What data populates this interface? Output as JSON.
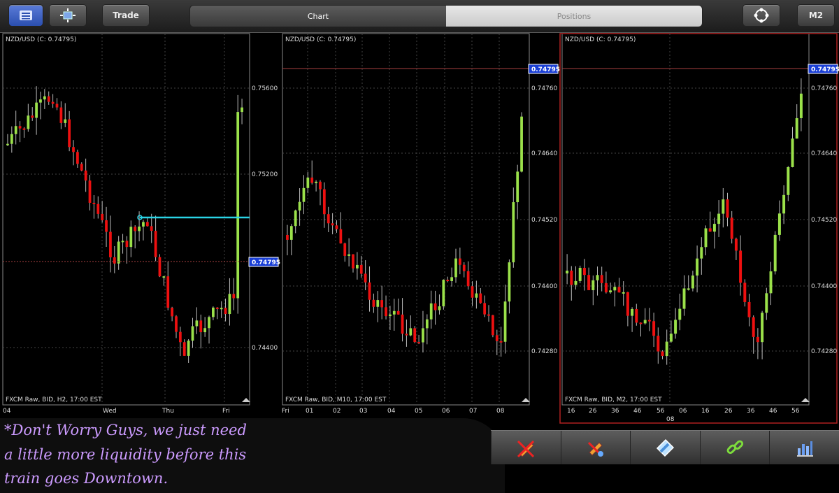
{
  "toolbar": {
    "trade_label": "Trade",
    "tab_chart": "Chart",
    "tab_positions": "Positions",
    "timeframe_label": "M2"
  },
  "charts": [
    {
      "title": "NZD/USD (C: 0.74795)",
      "source_label": "FXCM Raw, BID, H2, 17:00 EST",
      "price_ticks": [
        "0.75600",
        "0.75200",
        "0.74400"
      ],
      "current_price": "0.74795",
      "time_ticks": [
        "04",
        "Wed",
        "Thu",
        "Fri"
      ]
    },
    {
      "title": "NZD/USD (C: 0.74795)",
      "source_label": "FXCM Raw, BID, M10, 17:00 EST",
      "price_ticks": [
        "0.74760",
        "0.74640",
        "0.74520",
        "0.74400",
        "0.74280"
      ],
      "current_price": "0.74795",
      "time_ticks": [
        "Fri",
        "01",
        "02",
        "03",
        "04",
        "05",
        "06",
        "07",
        "08"
      ]
    },
    {
      "title": "NZD/USD (C: 0.74795)",
      "source_label": "FXCM Raw, BID, M2, 17:00 EST",
      "price_ticks": [
        "0.74760",
        "0.74640",
        "0.74520",
        "0.74400",
        "0.74280"
      ],
      "current_price": "0.74795",
      "time_ticks": [
        "16",
        "26",
        "36",
        "46",
        "56",
        "06",
        "16",
        "26",
        "36",
        "46",
        "56"
      ],
      "time_sub_label": "08"
    }
  ],
  "annotation": {
    "line1": "*Don't Worry Guys, we just need",
    "line2": "a little more liquidity before this",
    "line3": "train goes Downtown."
  },
  "icons": [
    "menu-icon",
    "crosshair-icon",
    "cycle-icon",
    "pencil-delete-icon",
    "pencil-settings-icon",
    "eraser-icon",
    "link-icon",
    "indicators-icon"
  ],
  "colors": {
    "bull": "#9be14a",
    "bear": "#ee1010",
    "accent_blue": "#1a3fd6",
    "selected_frame": "#b02020",
    "level_line": "#2ad4e6"
  }
}
